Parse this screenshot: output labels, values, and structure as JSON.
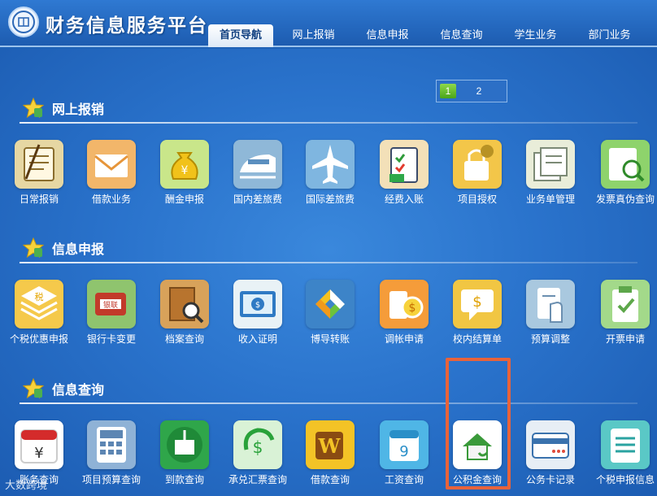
{
  "header": {
    "site_title": "财务信息服务平台",
    "tabs": [
      {
        "label": "首页导航",
        "active": true
      },
      {
        "label": "网上报销",
        "active": false
      },
      {
        "label": "信息申报",
        "active": false
      },
      {
        "label": "信息查询",
        "active": false
      },
      {
        "label": "学生业务",
        "active": false
      },
      {
        "label": "部门业务",
        "active": false
      }
    ]
  },
  "pager": {
    "pages": [
      "1",
      "2"
    ],
    "current": "1"
  },
  "sections": [
    {
      "title": "网上报销",
      "items": [
        {
          "label": "日常报销",
          "icon": "reimbursement-icon",
          "color": "#e6d7a3"
        },
        {
          "label": "借款业务",
          "icon": "envelope-icon",
          "color": "#f2b66a"
        },
        {
          "label": "酬金申报",
          "icon": "money-bag-icon",
          "color": "#c9e68a"
        },
        {
          "label": "国内差旅费",
          "icon": "train-icon",
          "color": "#8fb8d8"
        },
        {
          "label": "国际差旅费",
          "icon": "airplane-icon",
          "color": "#7fb6e0"
        },
        {
          "label": "经费入账",
          "icon": "clipboard-check-icon",
          "color": "#f3e0b8"
        },
        {
          "label": "项目授权",
          "icon": "lock-key-icon",
          "color": "#f3c649"
        },
        {
          "label": "业务单管理",
          "icon": "documents-icon",
          "color": "#e9edd9"
        },
        {
          "label": "发票真伪查询",
          "icon": "invoice-search-icon",
          "color": "#8ed36c"
        }
      ]
    },
    {
      "title": "信息申报",
      "items": [
        {
          "label": "个税优惠申报",
          "icon": "tax-icon",
          "color": "#f5c94b"
        },
        {
          "label": "银行卡变更",
          "icon": "bank-card-icon",
          "color": "#8fc46e"
        },
        {
          "label": "档案查询",
          "icon": "archive-search-icon",
          "color": "#d8a25a"
        },
        {
          "label": "收入证明",
          "icon": "income-certificate-icon",
          "color": "#e9f2f6"
        },
        {
          "label": "博导转账",
          "icon": "transfer-icon",
          "color": "#3d84c8"
        },
        {
          "label": "调帐申请",
          "icon": "coins-icon",
          "color": "#f59c3a"
        },
        {
          "label": "校内结算单",
          "icon": "settlement-icon",
          "color": "#f1c643"
        },
        {
          "label": "预算调整",
          "icon": "budget-adjust-icon",
          "color": "#a9c8df"
        },
        {
          "label": "开票申请",
          "icon": "invoice-apply-icon",
          "color": "#a3d98a"
        }
      ]
    },
    {
      "title": "信息查询",
      "items": [
        {
          "label": "账务查询",
          "icon": "calendar-yuan-icon",
          "color": "#ffffff"
        },
        {
          "label": "项目预算查询",
          "icon": "calculator-icon",
          "color": "#8fb2d6"
        },
        {
          "label": "到款查询",
          "icon": "inbox-download-icon",
          "color": "#2fa64a"
        },
        {
          "label": "承兑汇票查询",
          "icon": "dollar-cycle-icon",
          "color": "#d9f2d6"
        },
        {
          "label": "借款查询",
          "icon": "word-tile-icon",
          "color": "#f3c326"
        },
        {
          "label": "工资查询",
          "icon": "calendar-nine-icon",
          "color": "#4fb6e6"
        },
        {
          "label": "公积金查询",
          "icon": "house-smile-icon",
          "color": "#ffffff"
        },
        {
          "label": "公务卡记录",
          "icon": "credit-card-icon",
          "color": "#e7eef5"
        },
        {
          "label": "个税申报信息",
          "icon": "tax-list-icon",
          "color": "#5ac8c6"
        }
      ]
    }
  ],
  "watermark": "大数跨境"
}
